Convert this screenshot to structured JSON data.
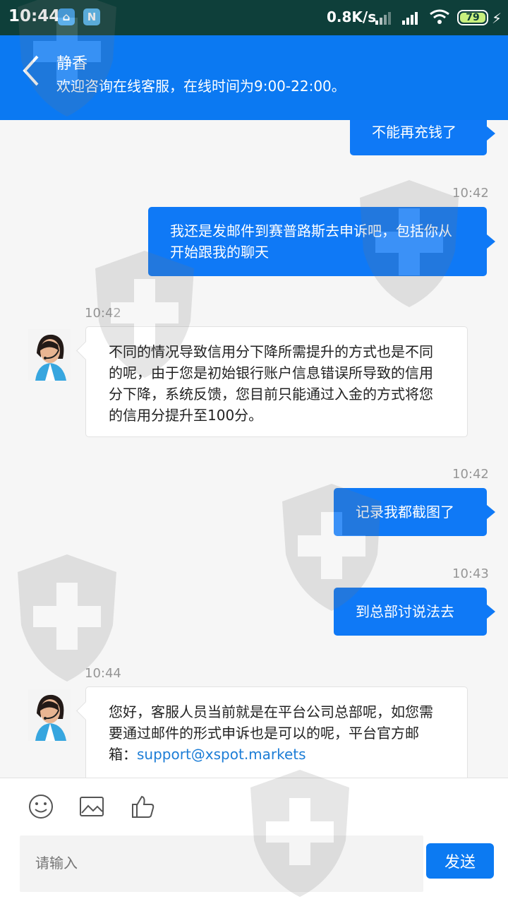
{
  "status": {
    "time": "10:44",
    "network_speed": "0.8K/s",
    "battery": "79",
    "charging_symbol": "⚡",
    "app_icon_one": "⌂",
    "app_icon_two": "N"
  },
  "header": {
    "agent_name": "静香",
    "service_note": "欢迎咨询在线客服，在线时间为9:00-22:00。"
  },
  "messages": [
    {
      "direction": "out",
      "text": "不能再充钱了"
    },
    {
      "time": "10:42",
      "direction": "out",
      "text": "我还是发邮件到赛普路斯去申诉吧，包括你从开始跟我的聊天"
    },
    {
      "time": "10:42",
      "direction": "in",
      "text": "不同的情况导致信用分下降所需提升的方式也是不同的呢，由于您是初始银行账户信息错误所导致的信用分下降，系统反馈，您目前只能通过入金的方式将您的信用分提升至100分。"
    },
    {
      "time": "10:42",
      "direction": "out",
      "text": "记录我都截图了"
    },
    {
      "time": "10:43",
      "direction": "out",
      "text": "到总部讨说法去"
    },
    {
      "time": "10:44",
      "direction": "in",
      "text": "您好，客服人员当前就是在平台公司总部呢，如您需要通过邮件的形式申诉也是可以的呢，平台官方邮箱：",
      "link": "support@xspot.markets"
    }
  ],
  "composer": {
    "placeholder": "请输入",
    "send_label": "发送"
  },
  "icons": {
    "back": "back-icon",
    "emoji": "emoji-icon",
    "image": "image-icon",
    "like": "thumbs-up-icon",
    "watermark": "shield-cross-watermark-icon"
  },
  "colors": {
    "status_bar": "#0e3f3a",
    "header": "#0b79f2",
    "outgoing_bubble": "#0f79f6",
    "incoming_bubble": "#ffffff",
    "link": "#1c7dd6"
  }
}
